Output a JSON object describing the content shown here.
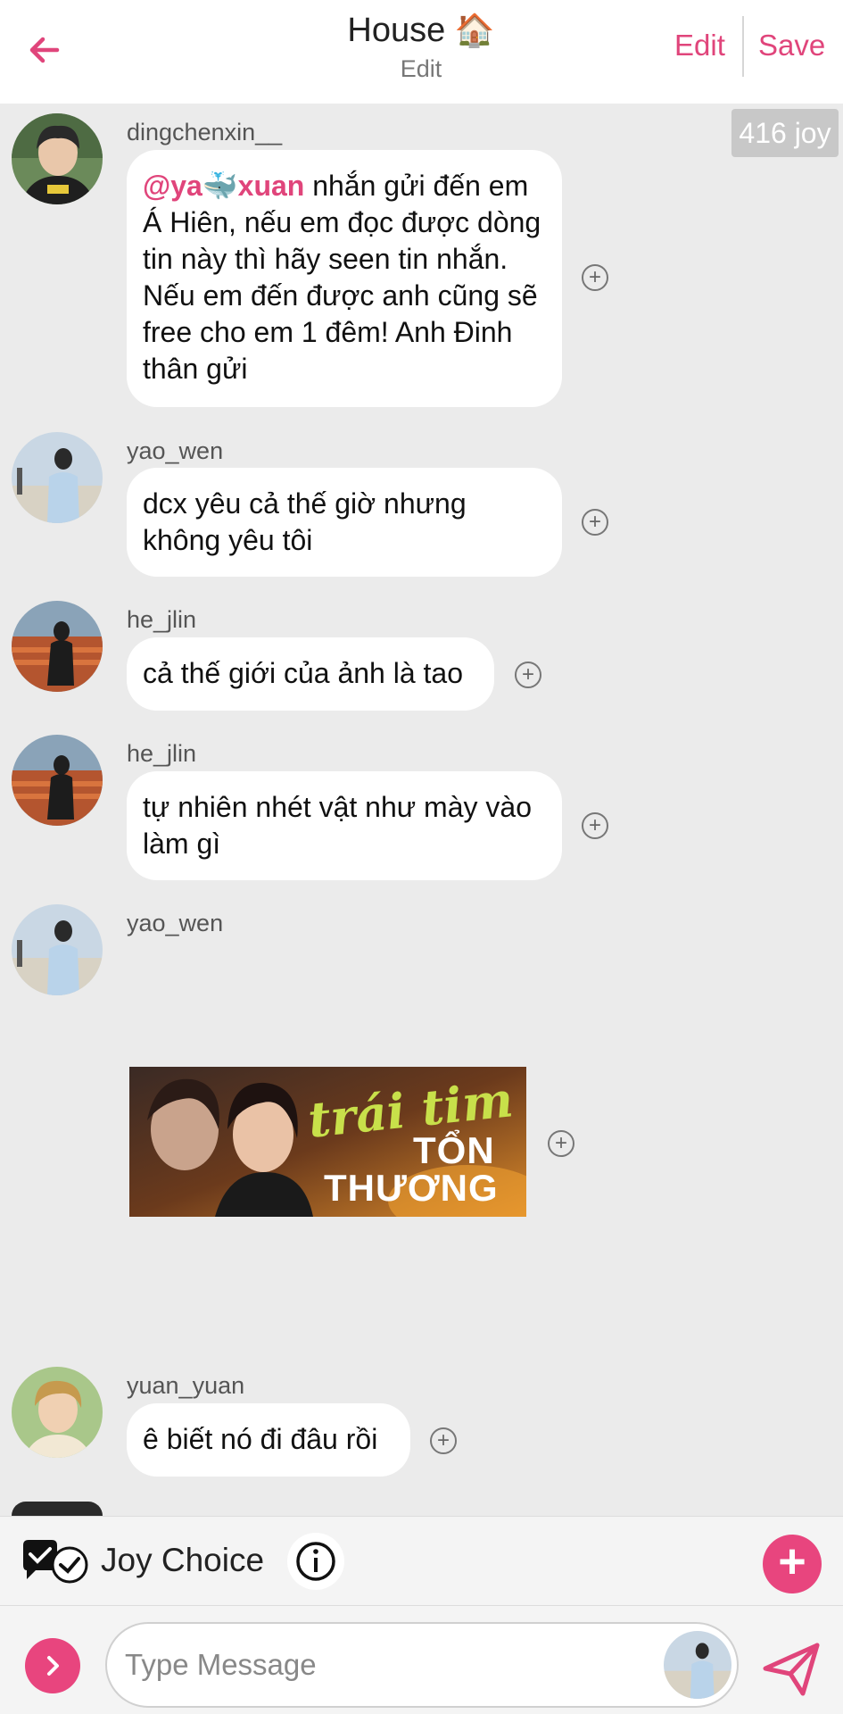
{
  "header": {
    "title": "House",
    "title_emoji": "🏠",
    "subtitle": "Edit",
    "edit_label": "Edit",
    "save_label": "Save",
    "back_icon": "arrow-left-icon"
  },
  "joy_badge": "416 joy",
  "messages": [
    {
      "username": "dingchenxin__",
      "mention": "@ya🐳xuan",
      "text": " nhắn gửi đến em Á Hiên, nếu em đọc được dòng tin này thì hãy seen tin nhắn. Nếu em đến được anh cũng sẽ free cho em 1 đêm! Anh Đinh thân gửi"
    },
    {
      "username": "yao_wen",
      "text": "dcx yêu cả thế giờ nhưng không yêu tôi"
    },
    {
      "username": "he_jlin",
      "text": "cả thế giới của ảnh là tao"
    },
    {
      "username": "he_jlin",
      "text": "tự nhiên nhét vật như mày vào làm gì"
    },
    {
      "username": "yao_wen",
      "image": {
        "line1": "trái tim",
        "line2": "TỔN",
        "line3": "THƯƠNG"
      }
    },
    {
      "username": "yuan_yuan",
      "text": "ê biết nó đi đâu rồi"
    }
  ],
  "choice_bar": {
    "label": "Joy Choice",
    "info_icon": "info-icon",
    "add_icon": "plus-icon"
  },
  "composer": {
    "placeholder": "Type Message",
    "send_icon": "send-icon",
    "expand_icon": "chevron-right-icon"
  },
  "colors": {
    "accent": "#e0457b",
    "background": "#ebebeb",
    "bubble": "#ffffff"
  }
}
